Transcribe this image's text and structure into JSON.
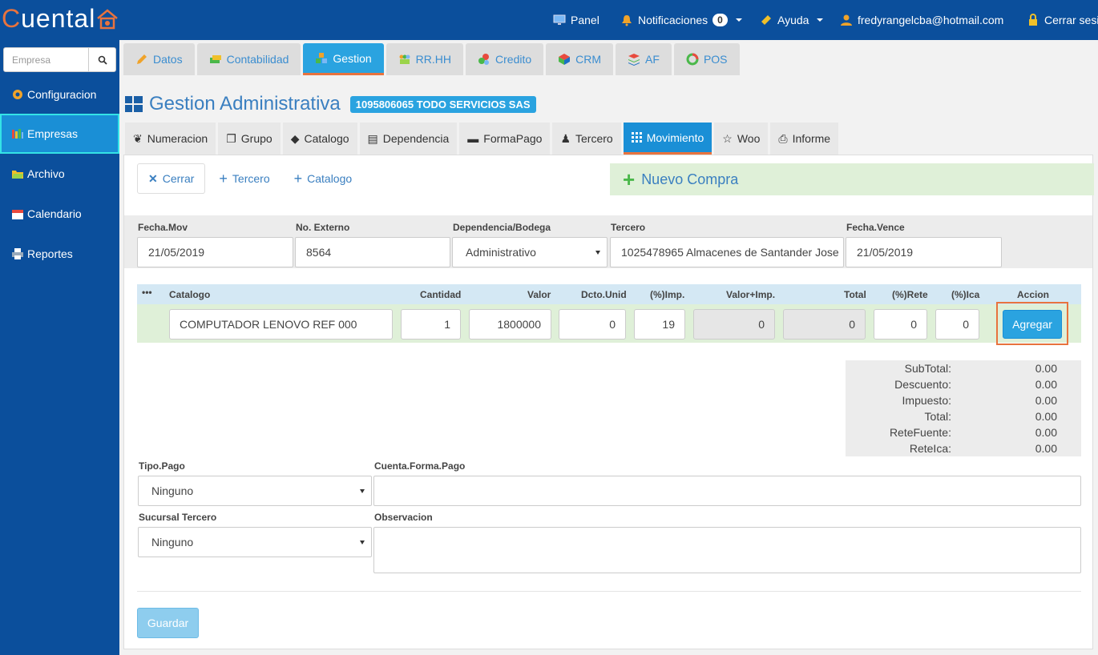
{
  "brand": {
    "logo_text": "Cuental"
  },
  "topnav": {
    "panel": "Panel",
    "notifications": "Notificaciones",
    "notifications_count": "0",
    "help": "Ayuda",
    "user_email": "fredyrangelcba@hotmail.com",
    "logout": "Cerrar sesi"
  },
  "sidebar": {
    "search_placeholder": "Empresa",
    "items": [
      {
        "label": "Configuracion",
        "icon": "gear-icon"
      },
      {
        "label": "Empresas",
        "icon": "bars-chart-icon"
      },
      {
        "label": "Archivo",
        "icon": "folder-icon"
      },
      {
        "label": "Calendario",
        "icon": "calendar-icon"
      },
      {
        "label": "Reportes",
        "icon": "printer-icon"
      }
    ]
  },
  "modules": [
    {
      "label": "Datos",
      "icon": "pencil-icon"
    },
    {
      "label": "Contabilidad",
      "icon": "money-icon"
    },
    {
      "label": "Gestion",
      "icon": "boxes-icon"
    },
    {
      "label": "RR.HH",
      "icon": "people-icon"
    },
    {
      "label": "Credito",
      "icon": "circles-icon"
    },
    {
      "label": "CRM",
      "icon": "cube-icon"
    },
    {
      "label": "AF",
      "icon": "layers-icon"
    },
    {
      "label": "POS",
      "icon": "ring-icon"
    }
  ],
  "page": {
    "title": "Gestion Administrativa",
    "company_label": "1095806065 TODO SERVICIOS SAS"
  },
  "subtabs": [
    {
      "label": "Numeracion",
      "icon": "ribbon-icon"
    },
    {
      "label": "Grupo",
      "icon": "copy-icon"
    },
    {
      "label": "Catalogo",
      "icon": "tag-icon"
    },
    {
      "label": "Dependencia",
      "icon": "cubes-icon"
    },
    {
      "label": "FormaPago",
      "icon": "card-icon"
    },
    {
      "label": "Tercero",
      "icon": "users-icon"
    },
    {
      "label": "Movimiento",
      "icon": "grid-icon"
    },
    {
      "label": "Woo",
      "icon": "star-icon"
    },
    {
      "label": "Informe",
      "icon": "printer-icon"
    }
  ],
  "actions": {
    "close": "Cerrar",
    "add_tercero": "Tercero",
    "add_catalogo": "Catalogo",
    "new_title": "Nuevo Compra"
  },
  "form": {
    "fecha_mov": {
      "label": "Fecha.Mov",
      "value": "21/05/2019"
    },
    "no_externo": {
      "label": "No. Externo",
      "value": "8564"
    },
    "dependencia": {
      "label": "Dependencia/Bodega",
      "value": "Administrativo"
    },
    "tercero": {
      "label": "Tercero",
      "value": "1025478965 Almacenes de Santander Jose"
    },
    "fecha_vence": {
      "label": "Fecha.Vence",
      "value": "21/05/2019"
    }
  },
  "grid": {
    "headers": {
      "more": "•••",
      "catalogo": "Catalogo",
      "cantidad": "Cantidad",
      "valor": "Valor",
      "dcto": "Dcto.Unid",
      "imp": "(%)Imp.",
      "valor_imp": "Valor+Imp.",
      "total": "Total",
      "rete": "(%)Rete",
      "ica": "(%)Ica",
      "accion": "Accion"
    },
    "row": {
      "catalogo": "COMPUTADOR LENOVO REF 000",
      "cantidad": "1",
      "valor": "1800000",
      "dcto": "0",
      "imp": "19",
      "valor_imp": "0",
      "total": "0",
      "rete": "0",
      "ica": "0"
    },
    "add_button": "Agregar"
  },
  "totals": [
    {
      "label": "SubTotal:",
      "value": "0.00"
    },
    {
      "label": "Descuento:",
      "value": "0.00"
    },
    {
      "label": "Impuesto:",
      "value": "0.00"
    },
    {
      "label": "Total:",
      "value": "0.00"
    },
    {
      "label": "ReteFuente:",
      "value": "0.00"
    },
    {
      "label": "ReteIca:",
      "value": "0.00"
    }
  ],
  "payment": {
    "tipo_pago": {
      "label": "Tipo.Pago",
      "value": "Ninguno"
    },
    "cuenta": {
      "label": "Cuenta.Forma.Pago",
      "value": ""
    },
    "sucursal": {
      "label": "Sucursal Tercero",
      "value": "Ninguno"
    },
    "observacion": {
      "label": "Observacion",
      "value": ""
    }
  },
  "save_button": "Guardar"
}
